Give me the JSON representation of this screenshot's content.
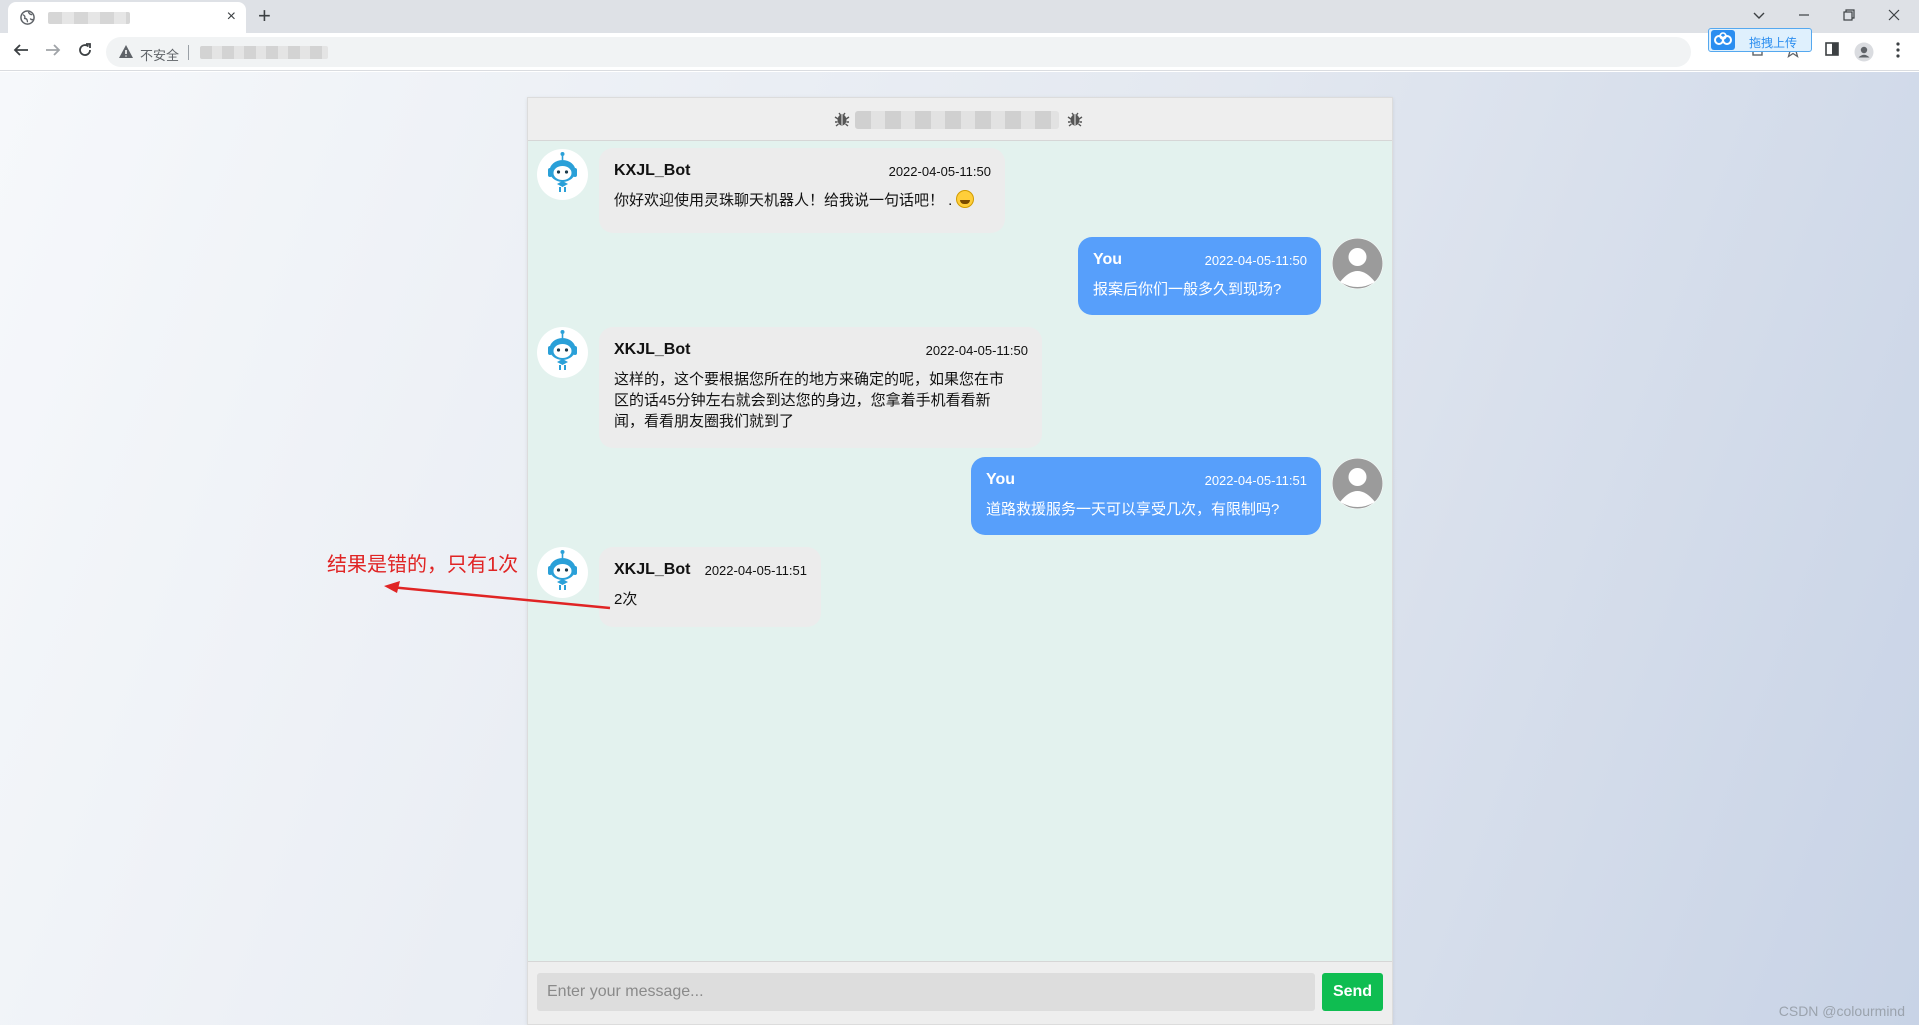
{
  "browser": {
    "insecure_label": "不安全",
    "upload_button": "拖拽上传",
    "close_tab": "×",
    "new_tab": "+"
  },
  "chat": {
    "messages": [
      {
        "side": "left",
        "name": "KXJL_Bot",
        "time": "2022-04-05-11:50",
        "text": "你好欢迎使用灵珠聊天机器人！给我说一句话吧！ ."
      },
      {
        "side": "right",
        "name": "You",
        "time": "2022-04-05-11:50",
        "text": "报案后你们一般多久到现场?"
      },
      {
        "side": "left",
        "name": "XKJL_Bot",
        "time": "2022-04-05-11:50",
        "text_lines": [
          "这样的，这个要根据您所在的地方来确定的呢，如果您在市",
          "区的话45分钟左右就会到达您的身边，您拿着手机看看新",
          "闻，看看朋友圈我们就到了"
        ]
      },
      {
        "side": "right",
        "name": "You",
        "time": "2022-04-05-11:51",
        "text": "道路救援服务一天可以享受几次，有限制吗?"
      },
      {
        "side": "left",
        "name": "XKJL_Bot",
        "time": "2022-04-05-11:51",
        "text": "2次"
      }
    ],
    "input_placeholder": "Enter your message...",
    "send_label": "Send"
  },
  "annotation": {
    "text": "结果是错的，只有1次",
    "color": "#e02424"
  },
  "watermark": "CSDN @colourmind",
  "colors": {
    "bot_bubble": "#ececec",
    "user_bubble": "#579ffb",
    "send_button": "#0fbd51",
    "chat_bg": "#e3f2ee"
  }
}
